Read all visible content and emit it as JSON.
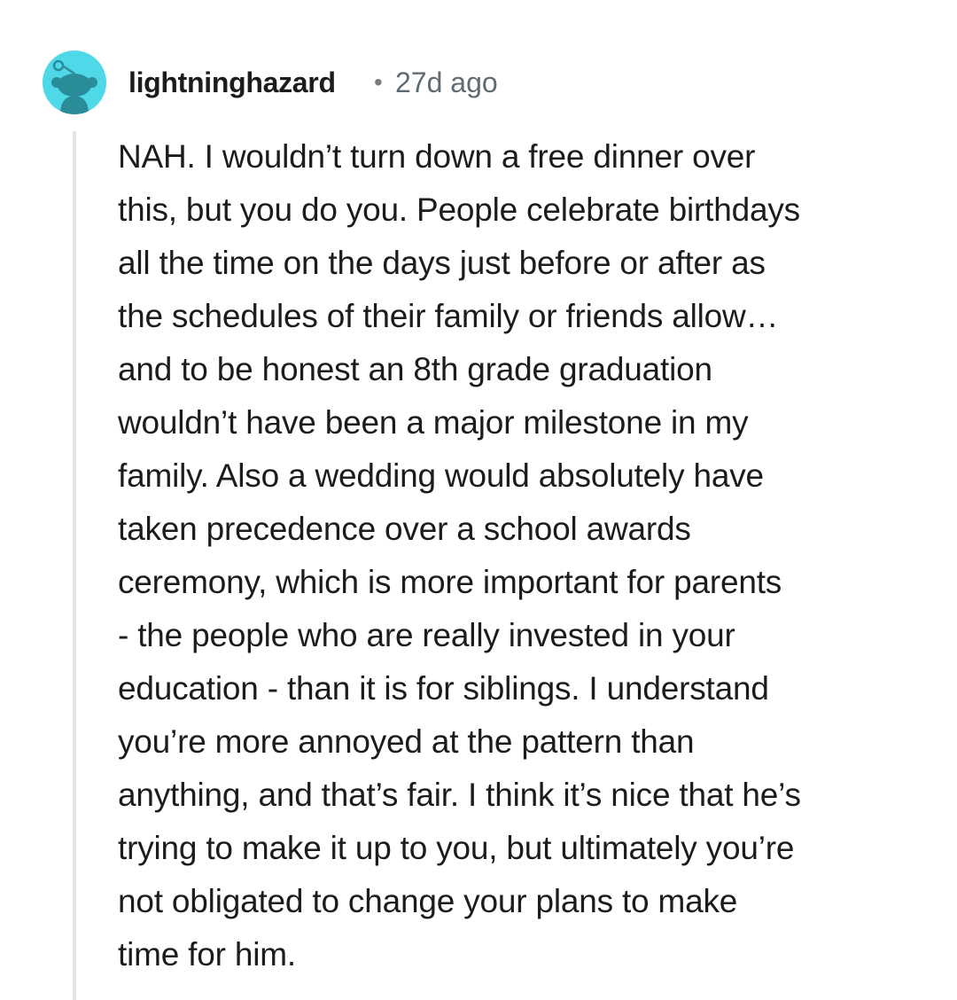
{
  "comment": {
    "username": "lightninghazard",
    "separator": "•",
    "timestamp": "27d ago",
    "avatar_icon": "reddit-snoo-avatar-icon",
    "avatar_color": "#4fd8e8",
    "body": "NAH. I wouldn’t turn down a free dinner over\nthis, but you do you. People celebrate birthdays\nall the time on the days just before or after as\nthe schedules of their family or friends allow…\nand to be honest an 8th grade graduation\nwouldn’t have been a major milestone in my\nfamily. Also a wedding would absolutely have\ntaken precedence over a school awards\nceremony, which is more important for parents\n- the people who are really invested in your\neducation - than it is for siblings. I understand\nyou’re more annoyed at the pattern than\nanything, and that’s fair. I think it’s nice that he’s\ntrying to make it up to you, but ultimately you’re\nnot obligated to change your plans to make\ntime for him."
  }
}
